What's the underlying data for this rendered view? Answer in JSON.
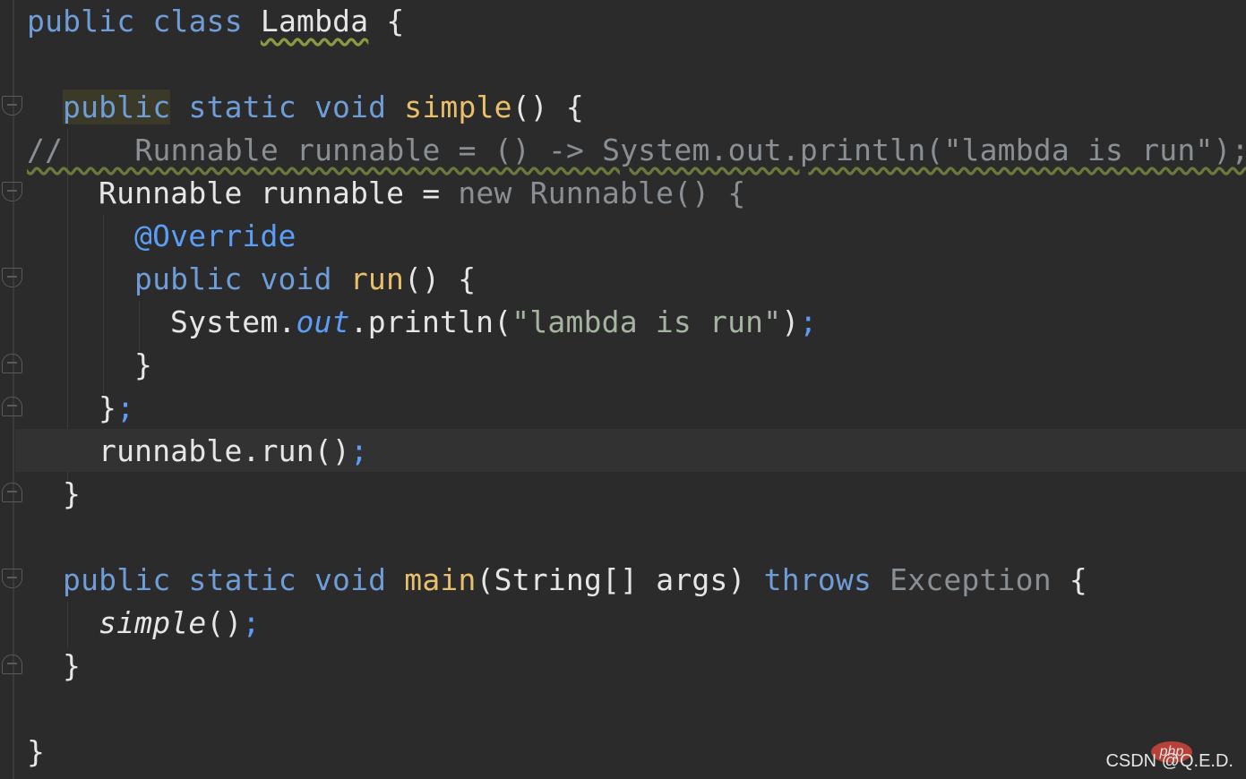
{
  "code": {
    "line1": {
      "kw": "public class ",
      "name": "Lambda",
      "brace": " {"
    },
    "line2": {
      "kw1": "public",
      "kw2": " static void ",
      "fn": "simple",
      "rest": "() {"
    },
    "line3": {
      "text": "//    Runnable runnable = () -> System.out.println(\"lambda is run\");"
    },
    "line4": {
      "a": "Runnable runnable = ",
      "b": "new Runnable",
      "c": "() {"
    },
    "line5": {
      "ann": "@Override"
    },
    "line6": {
      "kw": "public void ",
      "fn": "run",
      "rest": "() {"
    },
    "line7": {
      "a": "System.",
      "b": "out",
      "c": ".println(",
      "str": "\"lambda is run\"",
      "d": ")",
      "semi": ";"
    },
    "line8": {
      "text": "}"
    },
    "line9": {
      "text": "}",
      "semi": ";"
    },
    "line10": {
      "text": "runnable.run()",
      "semi": ";"
    },
    "line11": {
      "text": "}"
    },
    "line12": {
      "kw": "public static void ",
      "fn": "main",
      "a": "(String[] args) ",
      "kw2": "throws ",
      "dim": "Exception",
      "b": " {"
    },
    "line13": {
      "italic": "simple",
      "text": "()",
      "semi": ";"
    },
    "line14": {
      "text": "}"
    },
    "line15": {
      "text": "}"
    }
  },
  "watermark": {
    "logo": "php",
    "text": "CSDN @Q.E.D."
  }
}
